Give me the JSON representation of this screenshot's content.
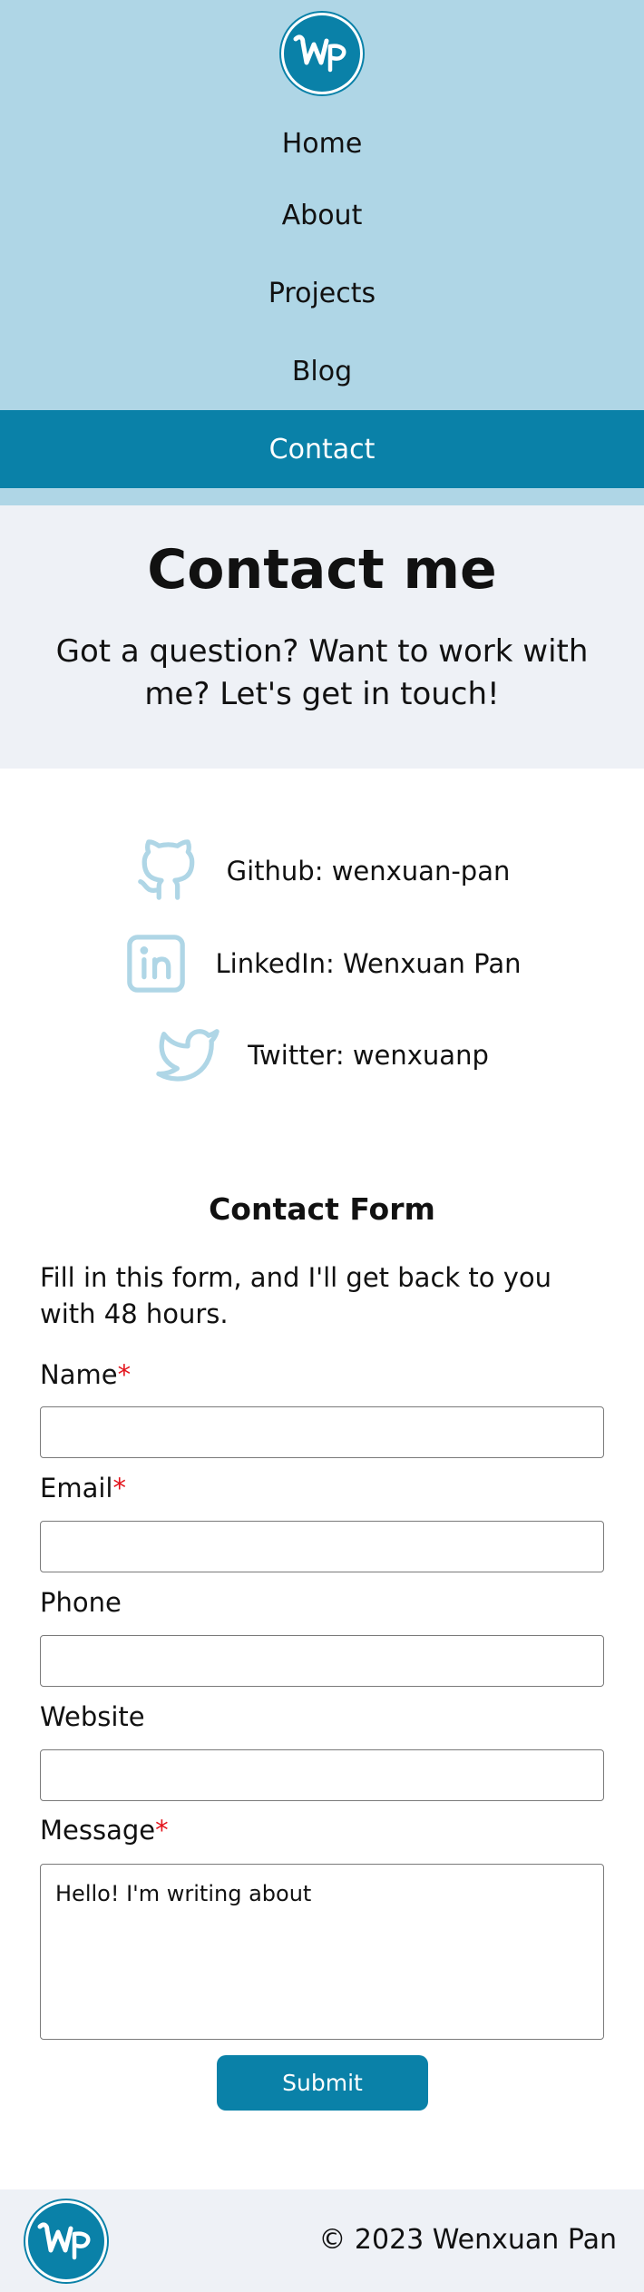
{
  "brand": {
    "logo_text": "WP",
    "primary_color": "#0a81a8",
    "nav_bg_color": "#afd6e6",
    "hero_bg_color": "#eef1f6",
    "icon_color": "#afd6e6",
    "required_color": "#e3131b"
  },
  "nav": {
    "items": [
      {
        "label": "Home"
      },
      {
        "label": "About"
      },
      {
        "label": "Projects"
      },
      {
        "label": "Blog"
      },
      {
        "label": "Contact",
        "active": true
      }
    ]
  },
  "hero": {
    "title": "Contact me",
    "subtitle": "Got a question? Want to work with me? Let's get in touch!"
  },
  "social": [
    {
      "icon": "github-icon",
      "text": "Github: wenxuan-pan"
    },
    {
      "icon": "linkedin-icon",
      "text": "LinkedIn: Wenxuan Pan"
    },
    {
      "icon": "twitter-icon",
      "text": "Twitter: wenxuanp"
    }
  ],
  "form": {
    "title": "Contact Form",
    "intro": "Fill in this form, and I'll get back to you with 48 hours.",
    "required_mark": "*",
    "fields": {
      "name": {
        "label": "Name",
        "value": "",
        "required": true
      },
      "email": {
        "label": "Email",
        "value": "",
        "required": true
      },
      "phone": {
        "label": "Phone",
        "value": "",
        "required": false
      },
      "website": {
        "label": "Website",
        "value": "",
        "required": false
      },
      "message": {
        "label": "Message",
        "value": "Hello! I'm writing about",
        "required": true
      }
    },
    "submit_label": "Submit"
  },
  "footer": {
    "copyright": "© 2023 Wenxuan Pan"
  }
}
